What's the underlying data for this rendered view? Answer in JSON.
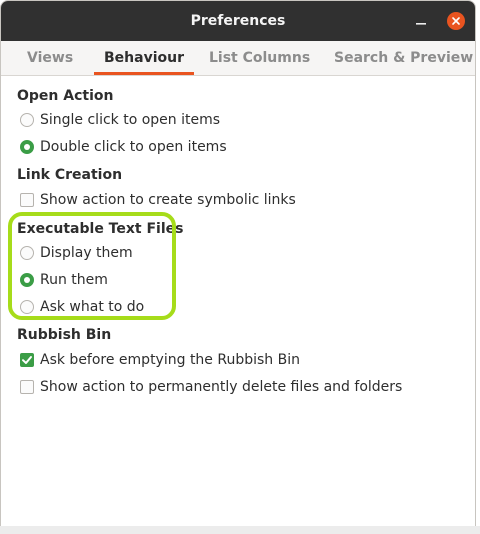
{
  "window": {
    "title": "Preferences",
    "colors": {
      "titlebar": "#303030",
      "accent": "#e95420",
      "selected": "#3b9d46",
      "highlight": "#a6dc1a"
    }
  },
  "tabs": [
    {
      "label": "Views",
      "active": false
    },
    {
      "label": "Behaviour",
      "active": true
    },
    {
      "label": "List Columns",
      "active": false
    },
    {
      "label": "Search & Preview",
      "active": false
    }
  ],
  "sections": {
    "open_action": {
      "title": "Open Action",
      "options": [
        {
          "label": "Single click to open items",
          "selected": false
        },
        {
          "label": "Double click to open items",
          "selected": true
        }
      ]
    },
    "link_creation": {
      "title": "Link Creation",
      "options": [
        {
          "label": "Show action to create symbolic links",
          "checked": false
        }
      ]
    },
    "executable_text_files": {
      "title": "Executable Text Files",
      "options": [
        {
          "label": "Display them",
          "selected": false
        },
        {
          "label": "Run them",
          "selected": true
        },
        {
          "label": "Ask what to do",
          "selected": false
        }
      ]
    },
    "rubbish_bin": {
      "title": "Rubbish Bin",
      "options": [
        {
          "label": "Ask before emptying the Rubbish Bin",
          "checked": true
        },
        {
          "label": "Show action to permanently delete files and folders",
          "checked": false
        }
      ]
    }
  },
  "icons": {
    "minimize": "minimize-icon",
    "close": "close-icon",
    "checkmark": "checkmark-icon"
  }
}
